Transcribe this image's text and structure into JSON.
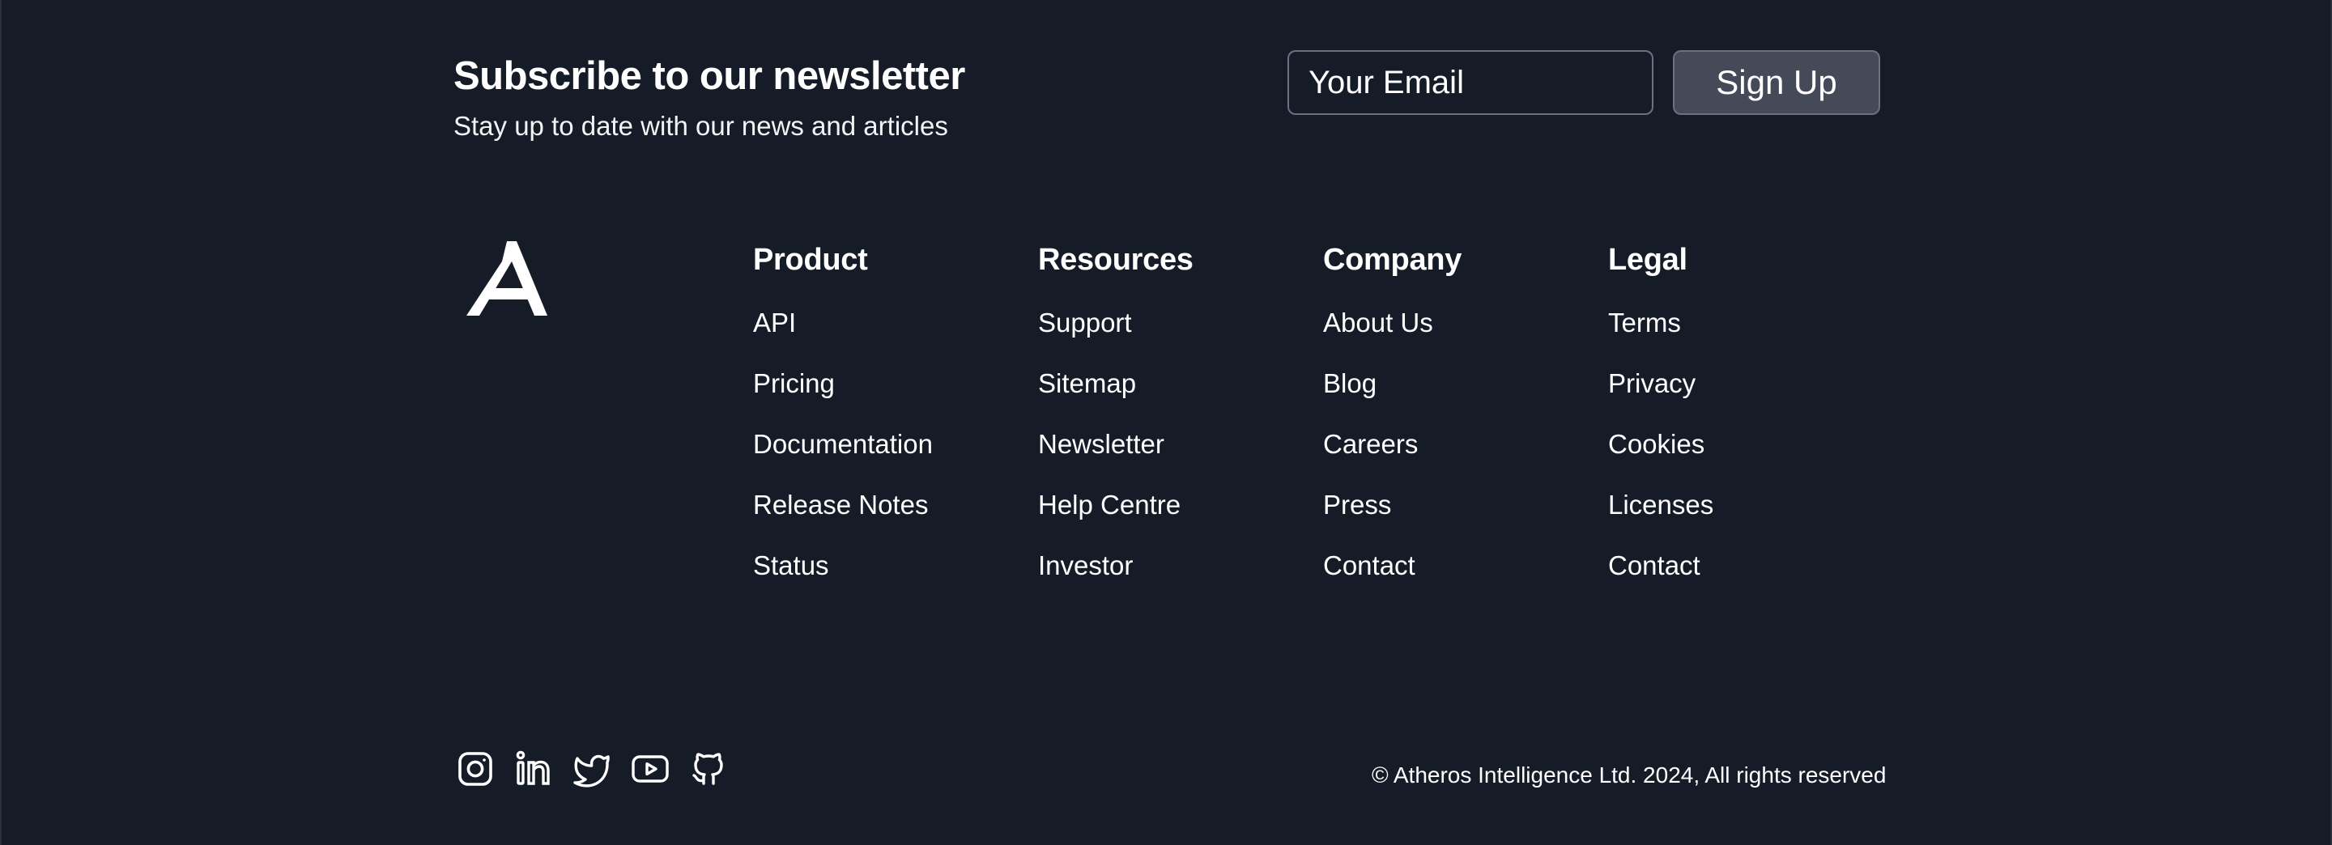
{
  "newsletter": {
    "title": "Subscribe to our newsletter",
    "subtitle": "Stay up to date with our news and articles",
    "email_placeholder": "Your Email",
    "signup_label": "Sign Up"
  },
  "logo": {
    "icon": "atheros-logo-icon"
  },
  "columns": [
    {
      "heading": "Product",
      "links": [
        "API",
        "Pricing",
        "Documentation",
        "Release Notes",
        "Status"
      ]
    },
    {
      "heading": "Resources",
      "links": [
        "Support",
        "Sitemap",
        "Newsletter",
        "Help Centre",
        "Investor"
      ]
    },
    {
      "heading": "Company",
      "links": [
        "About Us",
        "Blog",
        "Careers",
        "Press",
        "Contact"
      ]
    },
    {
      "heading": "Legal",
      "links": [
        "Terms",
        "Privacy",
        "Cookies",
        "Licenses",
        "Contact"
      ]
    }
  ],
  "socials": [
    "instagram-icon",
    "linkedin-icon",
    "twitter-icon",
    "youtube-icon",
    "github-icon"
  ],
  "footer": {
    "copyright": "© Atheros Intelligence Ltd. 2024, All rights reserved"
  },
  "colors": {
    "background": "#161b28",
    "button_background": "#444a58",
    "border": "#6b7180",
    "text": "#ffffff"
  }
}
